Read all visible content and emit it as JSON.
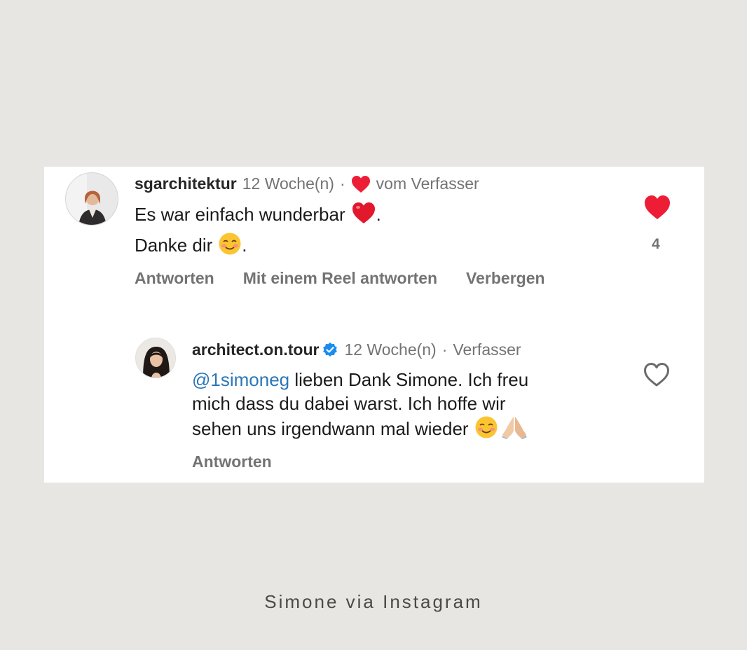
{
  "comments": [
    {
      "username": "sgarchitektur",
      "time": "12 Woche(n)",
      "separator": "·",
      "badge_text": "vom Verfasser",
      "lines": [
        "Es war einfach wunderbar",
        "Danke dir"
      ],
      "line_suffix": ".",
      "actions": [
        "Antworten",
        "Mit einem Reel antworten",
        "Verbergen"
      ],
      "like_count": "4",
      "liked": true
    },
    {
      "username": "architect.on.tour",
      "verified": true,
      "time": "12 Woche(n)",
      "separator": "·",
      "badge_text": "Verfasser",
      "mention": "@1simoneg",
      "lines": [
        "lieben Dank Simone. Ich freu",
        "mich dass du dabei warst. Ich hoffe wir",
        "sehen uns irgendwann mal wieder"
      ],
      "actions": [
        "Antworten"
      ],
      "liked": false
    }
  ],
  "caption": "Simone via Instagram",
  "colors": {
    "heart": "#ee1d36",
    "mention": "#2b77b8",
    "verified": "#1a8cf0",
    "muted": "#737373",
    "background": "#e8e6e2"
  },
  "icons": [
    "heart-icon",
    "heart-outline-icon",
    "verified-badge-icon",
    "red-heart-emoji",
    "smiling-face-emoji",
    "folded-hands-emoji"
  ]
}
